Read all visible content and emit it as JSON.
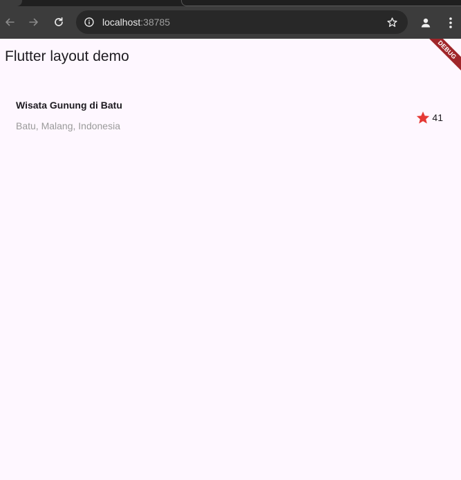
{
  "browser": {
    "url_host": "localhost",
    "url_port": ":38785",
    "icons": {
      "back": "arrow-left-icon",
      "forward": "arrow-right-icon",
      "reload": "reload-icon",
      "info": "info-icon",
      "bookmark": "star-outline-icon",
      "profile": "person-icon",
      "menu": "kebab-menu-icon"
    }
  },
  "app": {
    "title": "Flutter layout demo",
    "place": {
      "name": "Wisata Gunung di Batu",
      "location": "Batu, Malang, Indonesia",
      "rating_count": "41",
      "rating_icon": "star-icon"
    },
    "debug_banner": "DEBUG"
  },
  "colors": {
    "chrome_bg": "#3c3c3c",
    "omnibox_bg": "#282828",
    "app_bg": "#fef7ff",
    "star": "#e53935",
    "banner": "#a0262a",
    "secondary_text": "#9a9a9a"
  }
}
